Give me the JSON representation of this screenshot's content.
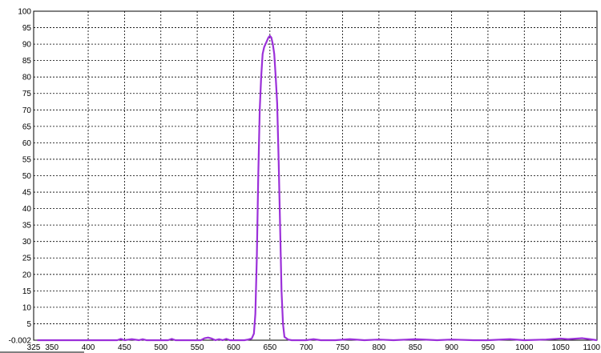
{
  "chart_data": {
    "type": "line",
    "title": "",
    "xlabel": "",
    "ylabel": "",
    "xlim": [
      325,
      1100
    ],
    "ylim": [
      -0.002,
      100
    ],
    "grid": true,
    "x_ticks": [
      325,
      350,
      400,
      450,
      500,
      550,
      600,
      650,
      700,
      750,
      800,
      850,
      900,
      950,
      1000,
      1050,
      1100
    ],
    "x_tick_labels": [
      "325",
      "350",
      "400",
      "450",
      "500",
      "550",
      "600",
      "650",
      "700",
      "750",
      "800",
      "850",
      "900",
      "950",
      "1000",
      "1050",
      "1100"
    ],
    "y_ticks": [
      0,
      5,
      10,
      15,
      20,
      25,
      30,
      35,
      40,
      45,
      50,
      55,
      60,
      65,
      70,
      75,
      80,
      85,
      90,
      95,
      100
    ],
    "y_tick_labels": [
      "-0.002",
      "5",
      "10",
      "15",
      "20",
      "25",
      "30",
      "35",
      "40",
      "45",
      "50",
      "55",
      "60",
      "65",
      "70",
      "75",
      "80",
      "85",
      "90",
      "95",
      "100"
    ],
    "series": [
      {
        "color": "#9b30d9",
        "x": [
          330,
          440,
          445,
          450,
          460,
          470,
          475,
          480,
          500,
          510,
          515,
          520,
          555,
          560,
          565,
          570,
          575,
          580,
          585,
          590,
          595,
          600,
          605,
          610,
          615,
          620,
          625,
          628,
          630,
          632,
          634,
          636,
          638,
          640,
          642,
          644,
          646,
          648,
          650,
          652,
          654,
          656,
          658,
          660,
          662,
          664,
          666,
          668,
          670,
          675,
          680,
          690,
          700,
          710,
          720,
          740,
          760,
          780,
          800,
          820,
          850,
          880,
          900,
          930,
          950,
          980,
          1000,
          1030,
          1050,
          1060,
          1080,
          1090,
          1100
        ],
        "y": [
          0,
          0,
          0.4,
          0,
          0.3,
          0,
          0.3,
          0,
          0,
          0,
          0.4,
          0,
          0,
          0.6,
          0.8,
          0.5,
          0,
          0.3,
          0,
          0.4,
          0,
          0,
          0,
          0,
          0,
          0.2,
          0.5,
          2,
          8,
          25,
          50,
          70,
          80,
          87,
          89,
          90,
          91,
          92,
          92.5,
          92,
          90,
          87,
          80,
          72,
          55,
          35,
          15,
          5,
          1,
          0.2,
          0,
          0,
          0,
          0.3,
          0,
          0,
          0.3,
          0,
          0.2,
          0,
          0.3,
          0,
          0.2,
          0,
          0,
          0.3,
          0,
          0.2,
          0.5,
          0.3,
          0.6,
          0.3,
          0
        ]
      }
    ]
  }
}
